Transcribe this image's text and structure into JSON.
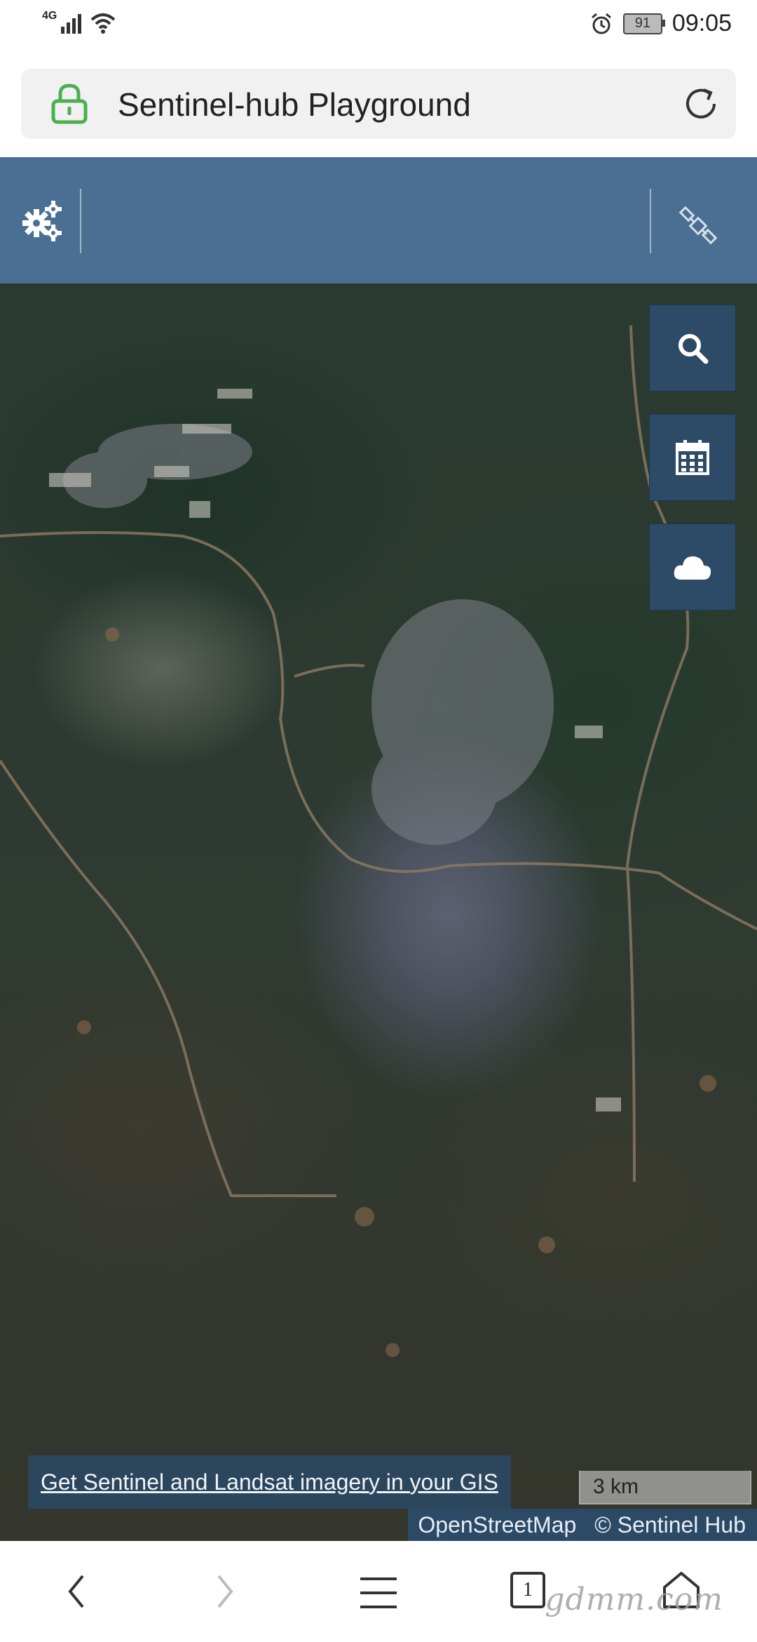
{
  "status_bar": {
    "network": "4G",
    "battery": "91",
    "time": "09:05"
  },
  "browser": {
    "title": "Sentinel-hub Playground"
  },
  "app_header": {
    "settings_icon": "gears-icon",
    "satellite_icon": "satellite-icon"
  },
  "map_controls": [
    {
      "name": "search-button",
      "icon": "search-icon"
    },
    {
      "name": "calendar-button",
      "icon": "calendar-icon"
    },
    {
      "name": "cloud-button",
      "icon": "cloud-icon"
    }
  ],
  "map": {
    "promo_link": "Get Sentinel and Landsat imagery in your GIS",
    "scale_label": "3 km",
    "attribution_osm": "OpenStreetMap",
    "attribution_sh": "© Sentinel Hub"
  },
  "nav_bar": {
    "tabs_count": "1",
    "watermark": "gdmm.com"
  },
  "colors": {
    "header": "#4a6f93",
    "map_button": "#2d4a66",
    "lock": "#4caf50"
  }
}
